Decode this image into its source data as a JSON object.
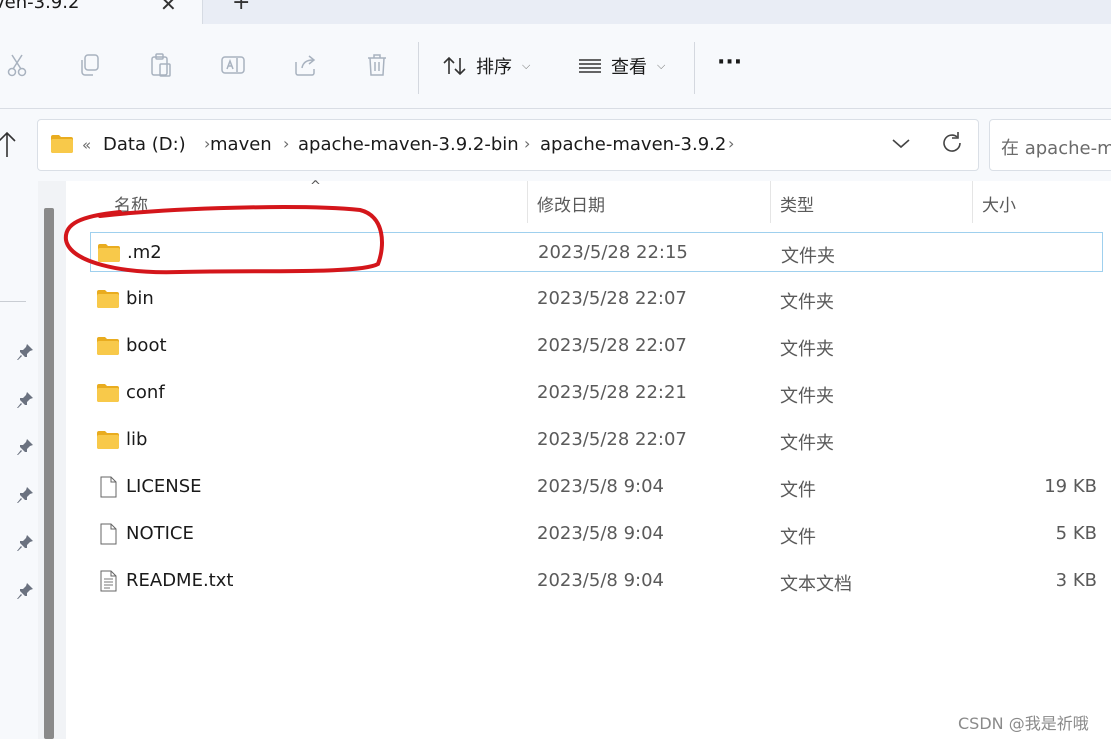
{
  "tab": {
    "title": "ven-3.9.2",
    "close_label": "✕",
    "new_tab_label": "+"
  },
  "toolbar": {
    "icons": [
      "cut-icon",
      "copy-icon",
      "paste-icon",
      "rename-icon",
      "share-icon",
      "delete-icon"
    ],
    "sort_label": "排序",
    "view_label": "查看",
    "more_label": "···"
  },
  "address": {
    "overflow": "«",
    "crumbs": [
      "Data (D:)",
      "maven",
      "apache-maven-3.9.2-bin",
      "apache-maven-3.9.2"
    ],
    "separator": "›"
  },
  "search": {
    "placeholder": "在 apache-m"
  },
  "columns": {
    "name": "名称",
    "modified": "修改日期",
    "type": "类型",
    "size": "大小",
    "sort_indicator": "^"
  },
  "files": [
    {
      "name": ".m2",
      "modified": "2023/5/28 22:15",
      "type": "文件夹",
      "size": "",
      "kind": "folder",
      "selected": true
    },
    {
      "name": "bin",
      "modified": "2023/5/28 22:07",
      "type": "文件夹",
      "size": "",
      "kind": "folder"
    },
    {
      "name": "boot",
      "modified": "2023/5/28 22:07",
      "type": "文件夹",
      "size": "",
      "kind": "folder"
    },
    {
      "name": "conf",
      "modified": "2023/5/28 22:21",
      "type": "文件夹",
      "size": "",
      "kind": "folder"
    },
    {
      "name": "lib",
      "modified": "2023/5/28 22:07",
      "type": "文件夹",
      "size": "",
      "kind": "folder"
    },
    {
      "name": "LICENSE",
      "modified": "2023/5/8 9:04",
      "type": "文件",
      "size": "19 KB",
      "kind": "file"
    },
    {
      "name": "NOTICE",
      "modified": "2023/5/8 9:04",
      "type": "文件",
      "size": "5 KB",
      "kind": "file"
    },
    {
      "name": "README.txt",
      "modified": "2023/5/8 9:04",
      "type": "文本文档",
      "size": "3 KB",
      "kind": "text"
    }
  ],
  "watermark": "CSDN @我是祈哦",
  "colors": {
    "folder": "#f8c94a",
    "folder_dark": "#e9ac1f",
    "selection_border": "#9fd0ee",
    "annotation": "#d4161b"
  }
}
